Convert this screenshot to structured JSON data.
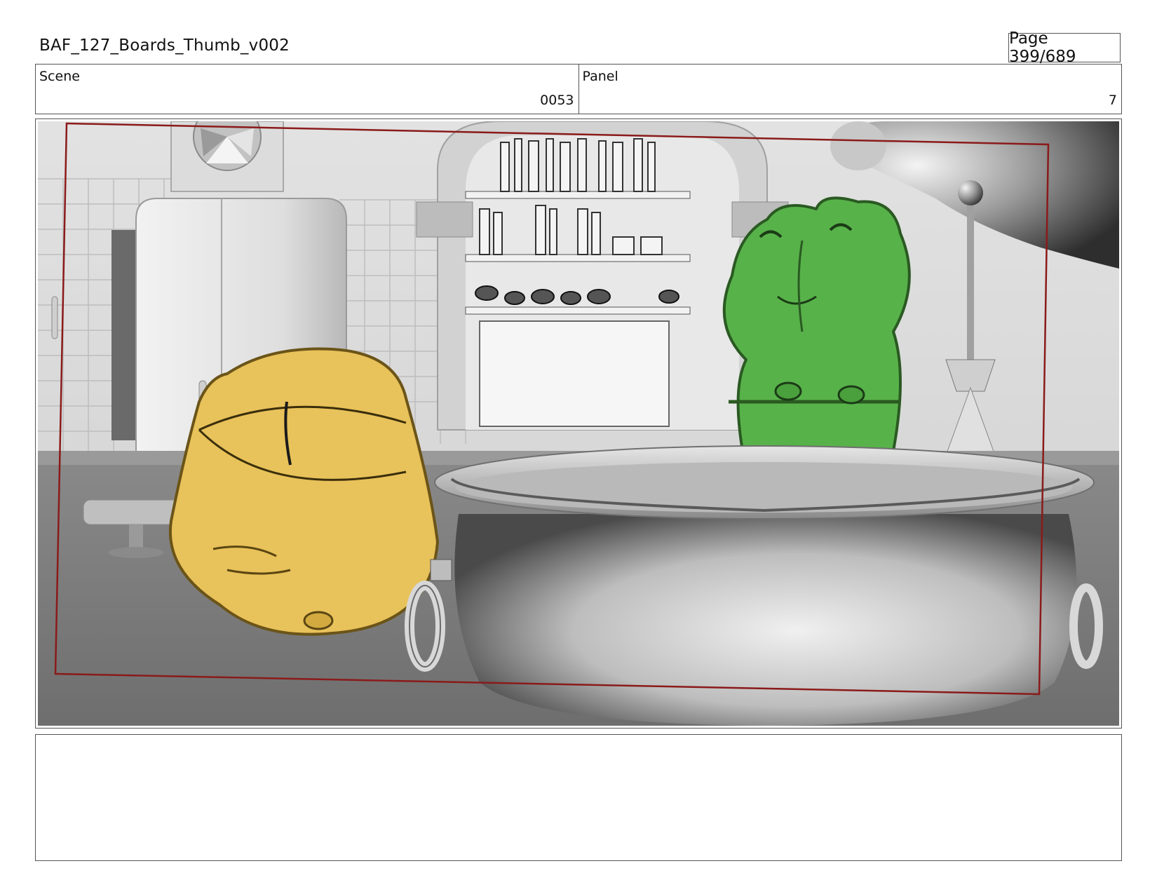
{
  "header": {
    "title": "BAF_127_Boards_Thumb_v002",
    "page_label": "Page 399/689"
  },
  "info": {
    "scene_label": "Scene",
    "scene_value": "0053",
    "panel_label": "Panel",
    "panel_value": "7"
  },
  "panel_image": {
    "description_name": "storyboard-panel",
    "colors": {
      "background": "#d8d8d8",
      "floor": "#7a7a7a",
      "yellow_character": "#e8c25a",
      "green_character": "#58b24a",
      "safe_frame": "#8b1a1a",
      "cauldron": "#c4c4c4"
    }
  },
  "notes": {
    "text": ""
  }
}
